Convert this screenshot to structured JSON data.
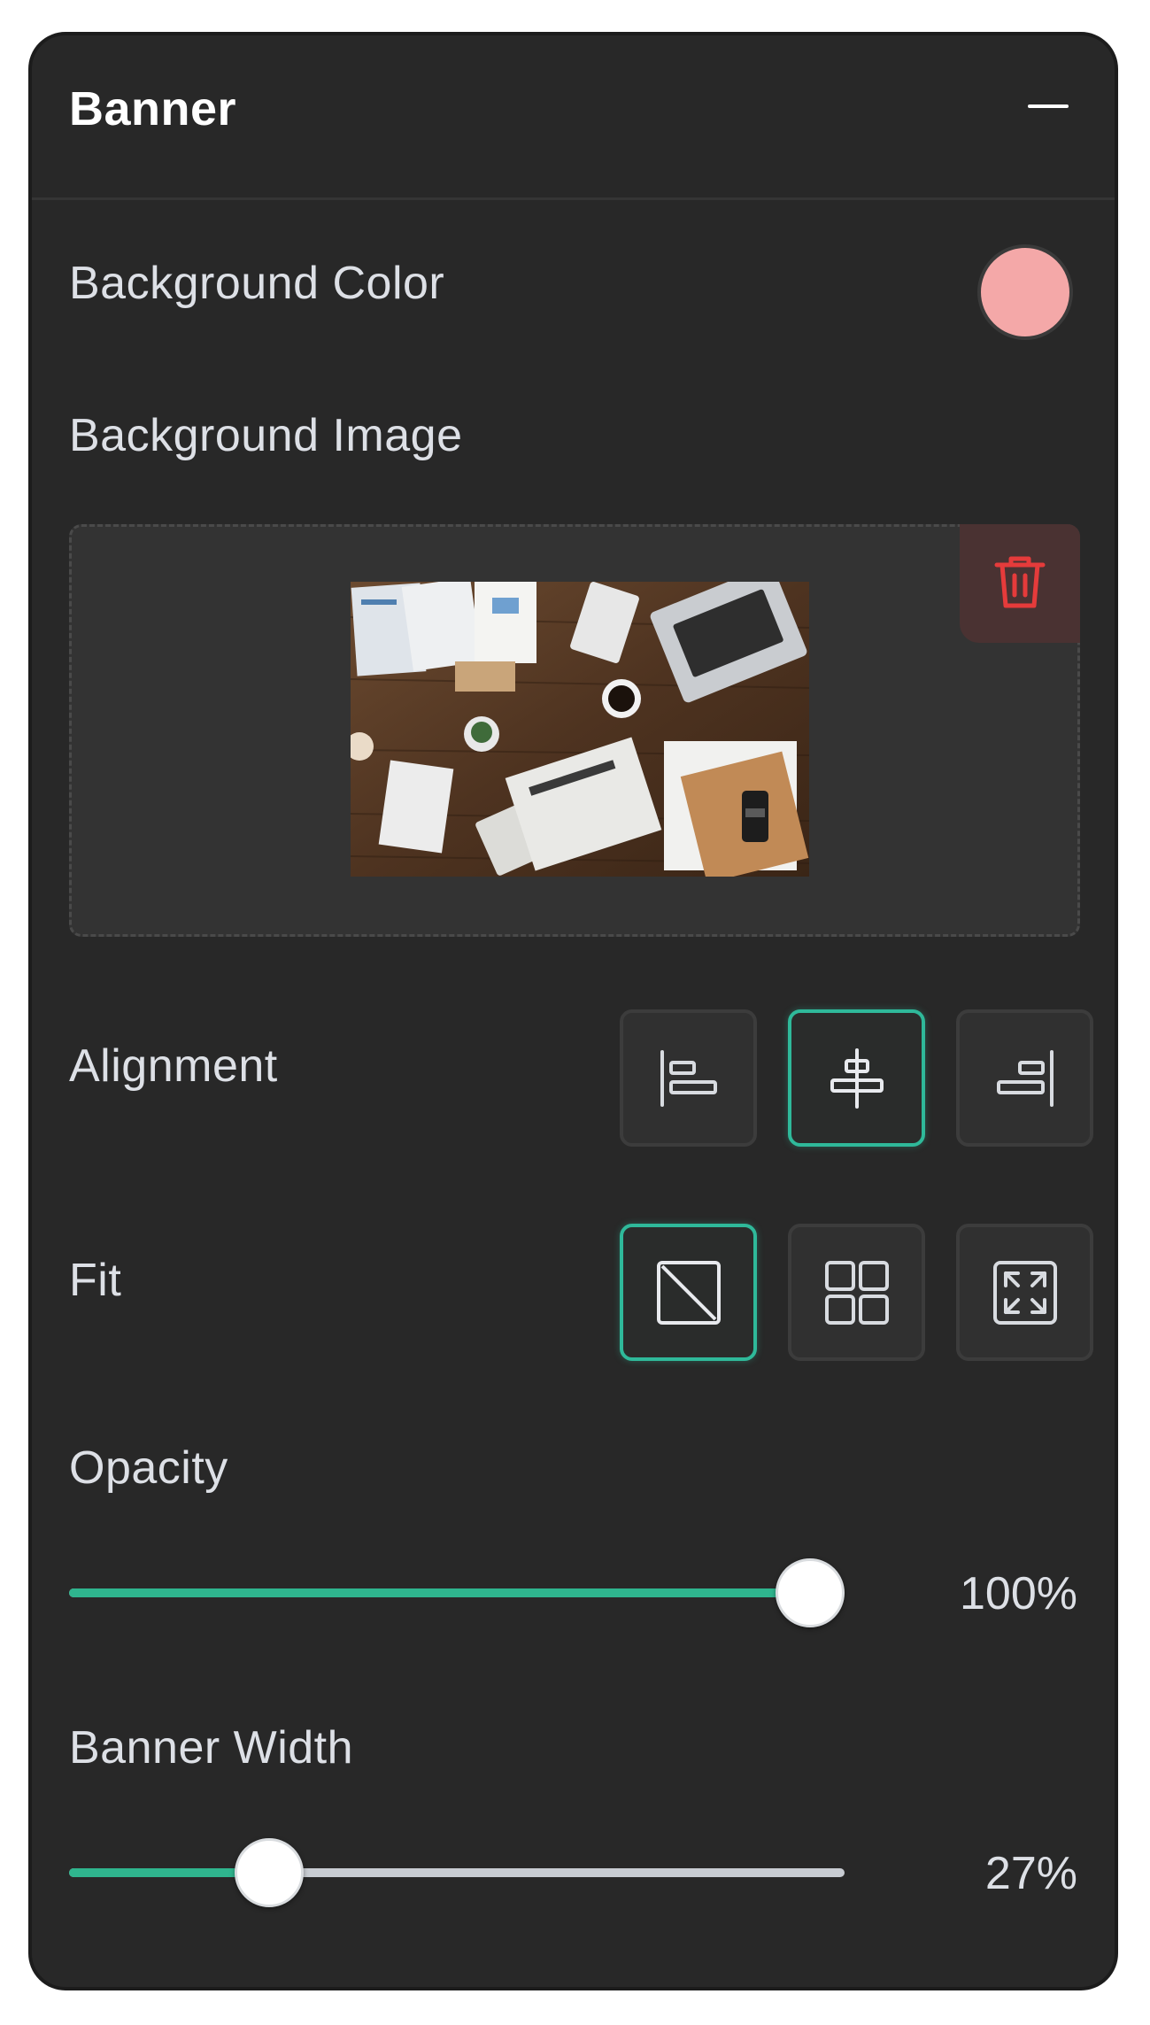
{
  "panel": {
    "title": "Banner",
    "collapse_icon": "minus-icon"
  },
  "background_color": {
    "label": "Background Color",
    "value": "#f4a8a8"
  },
  "background_image": {
    "label": "Background Image",
    "delete_icon": "trash-icon",
    "delete_icon_color": "#e53b3b"
  },
  "alignment": {
    "label": "Alignment",
    "options": [
      "align-left-icon",
      "align-center-icon",
      "align-right-icon"
    ],
    "selected": "align-center-icon"
  },
  "fit": {
    "label": "Fit",
    "options": [
      "fit-none-icon",
      "fit-tile-icon",
      "fit-expand-icon"
    ],
    "selected": "fit-none-icon"
  },
  "opacity": {
    "label": "Opacity",
    "value": 100,
    "value_text": "100%"
  },
  "banner_width": {
    "label": "Banner Width",
    "value": 27,
    "value_text": "27%"
  },
  "colors": {
    "panel_bg": "#282828",
    "accent": "#2fb99a",
    "slider_fill": "#2fb58e",
    "delete_bg": "#4a3232"
  }
}
